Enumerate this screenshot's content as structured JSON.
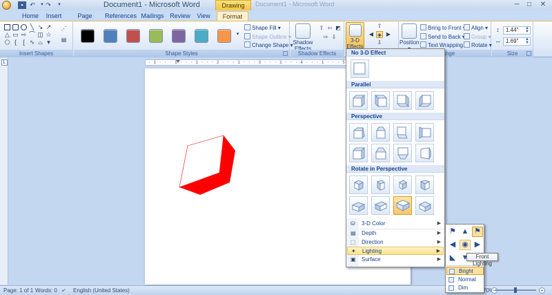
{
  "window": {
    "title": "Document1 - Microsoft Word",
    "contextual_tab_group": "Drawing Tools",
    "ghost_title": "Document1 - Microsoft Word",
    "qat": {
      "save_icon": "save-icon",
      "undo_glyph": "↶",
      "redo_glyph": "↷"
    },
    "controls": {
      "minimize": "─",
      "maximize": "□",
      "close": "✕"
    }
  },
  "tabs": [
    "Home",
    "Insert",
    "Page Layout",
    "References",
    "Mailings",
    "Review",
    "View",
    "Format"
  ],
  "active_tab": "Format",
  "ribbon": {
    "groups": {
      "insert_shapes": "Insert Shapes",
      "shape_styles": "Shape Styles",
      "shadow_effects": "Shadow Effects",
      "three_d_effects": "3-D Effects",
      "arrange": "Arrange",
      "size": "Size"
    },
    "shape_styles": {
      "swatches": [
        "#000000",
        "#4f81bd",
        "#c0504d",
        "#9bbb59",
        "#8064a2",
        "#4bacc6",
        "#f79646"
      ],
      "shape_fill": "Shape Fill",
      "shape_outline": "Shape Outline",
      "change_shape": "Change Shape"
    },
    "shadow_effects_button": [
      "Shadow",
      "Effects"
    ],
    "three_d_button": [
      "3-D",
      "Effects"
    ],
    "arrange": {
      "position": "Position",
      "bring_to_front": "Bring to Front",
      "send_to_back": "Send to Back",
      "text_wrapping": "Text Wrapping",
      "align": "Align",
      "group": "Group",
      "rotate": "Rotate"
    },
    "size": {
      "height": "1.44\"",
      "width": "1.69\""
    }
  },
  "ruler_text": "· 1 · · · 1 · · · 1 · · · 2 · · · 1 · · · 3 · · · 1 · · · 4 · · · 1 · · · 5 · · · 1 · · · 6 · · · 1 ·",
  "document": {
    "shape_color": "#ff0000"
  },
  "effects_3d_menu": {
    "headers": {
      "none": "No 3-D Effect",
      "parallel": "Parallel",
      "perspective": "Perspective",
      "rotate_perspective": "Rotate in Perspective"
    },
    "items": [
      {
        "label": "3-D Color",
        "icon": "paint-bucket-icon"
      },
      {
        "label": "Depth",
        "icon": "depth-icon"
      },
      {
        "label": "Direction",
        "icon": "direction-icon"
      },
      {
        "label": "Lighting",
        "icon": "lighting-icon"
      },
      {
        "label": "Surface",
        "icon": "surface-icon"
      }
    ],
    "active_item": "Lighting"
  },
  "lighting_flyout": {
    "options": [
      "Bright",
      "Normal",
      "Dim"
    ],
    "selected_option": "Bright",
    "tooltip": "Front Lighting"
  },
  "status": {
    "page": "Page: 1 of 1",
    "words": "Words: 0",
    "language": "English (United States)",
    "zoom": "70%"
  }
}
